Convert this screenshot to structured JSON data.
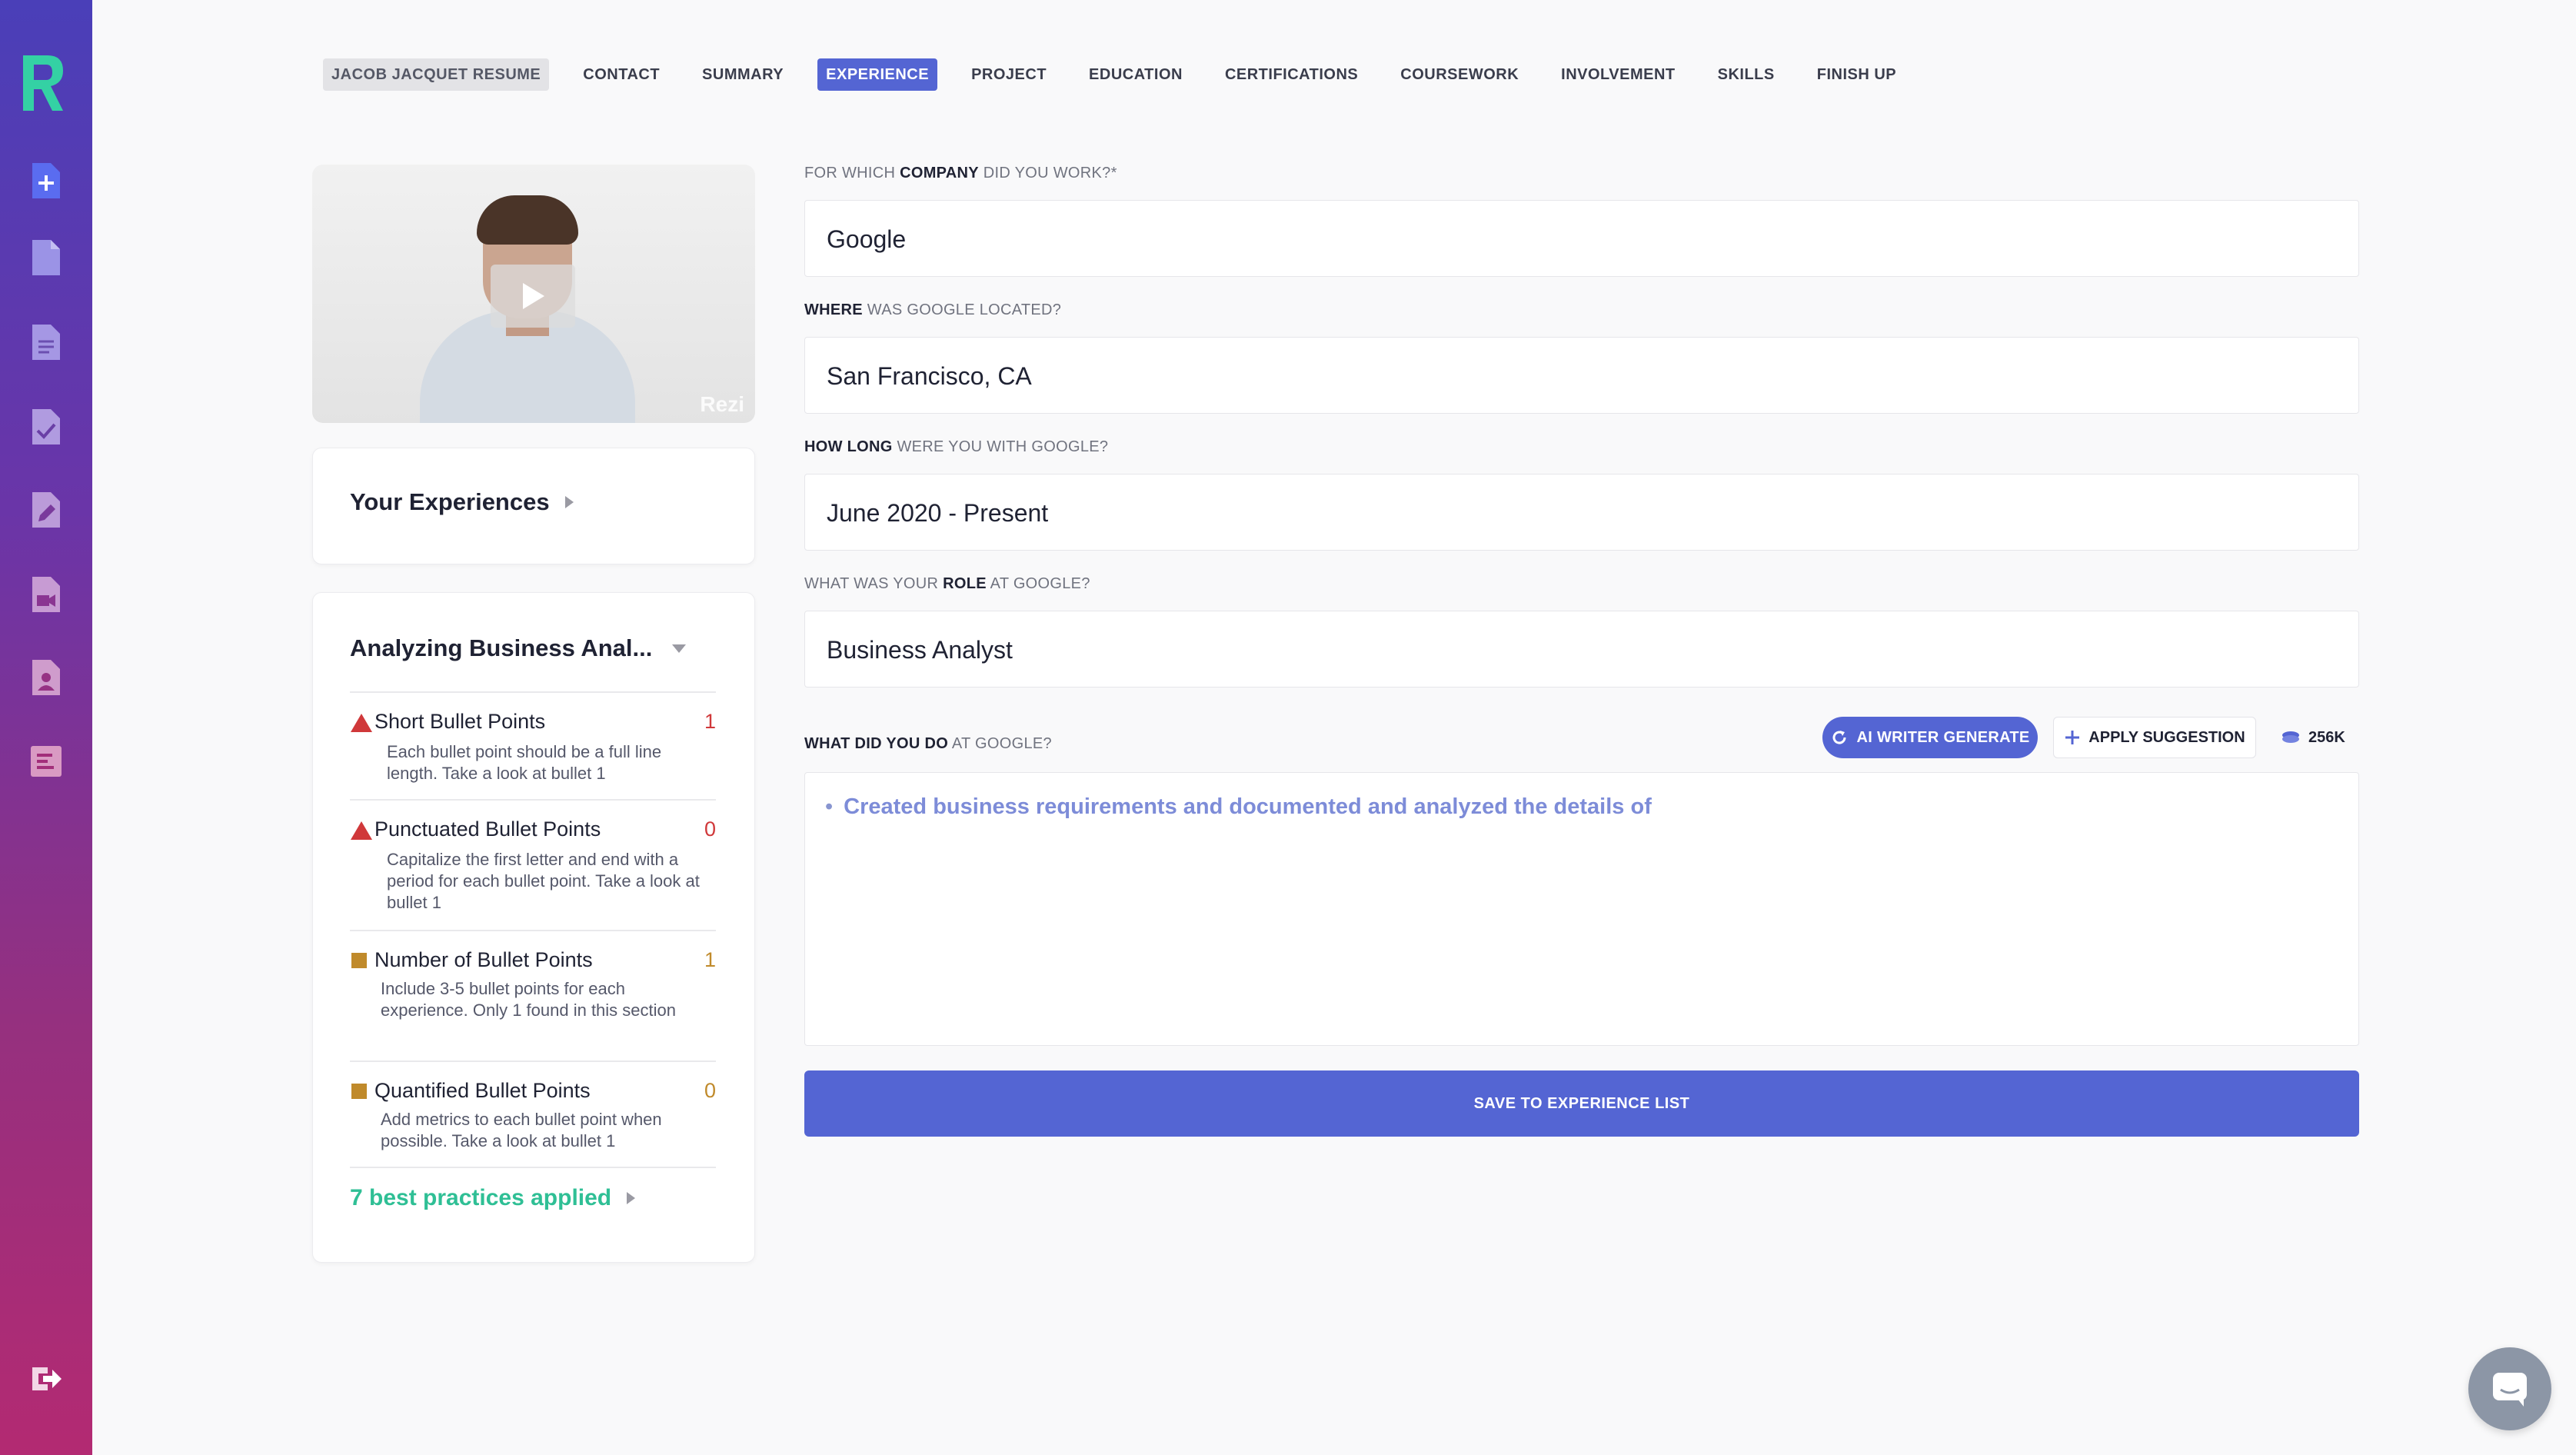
{
  "sidebar": {
    "logo": "rezi-logo",
    "items": [
      {
        "icon": "add-document-icon"
      },
      {
        "icon": "document-icon"
      },
      {
        "icon": "text-document-icon"
      },
      {
        "icon": "checked-document-icon"
      },
      {
        "icon": "edit-document-icon"
      },
      {
        "icon": "video-document-icon"
      },
      {
        "icon": "profile-document-icon"
      },
      {
        "icon": "report-icon"
      }
    ],
    "logout_icon": "logout-icon"
  },
  "nav": {
    "brand": "JACOB JACQUET RESUME",
    "items": [
      "CONTACT",
      "SUMMARY",
      "EXPERIENCE",
      "PROJECT",
      "EDUCATION",
      "CERTIFICATIONS",
      "COURSEWORK",
      "INVOLVEMENT",
      "SKILLS",
      "FINISH UP"
    ],
    "active": "EXPERIENCE"
  },
  "video": {
    "watermark": "Rezi"
  },
  "experiences": {
    "title": "Your Experiences"
  },
  "analysis": {
    "title": "Analyzing Business Anal...",
    "items": [
      {
        "name": "Short Bullet Points",
        "count": "1",
        "level": "error",
        "desc": "Each bullet point should be a full line length. Take a look at bullet 1"
      },
      {
        "name": "Punctuated Bullet Points",
        "count": "0",
        "level": "error",
        "desc": "Capitalize the first letter and end with a period for each bullet point. Take a look at bullet 1"
      },
      {
        "name": "Number of Bullet Points",
        "count": "1",
        "level": "warning",
        "desc": "Include 3-5 bullet points for each experience. Only 1 found in this section"
      },
      {
        "name": "Quantified Bullet Points",
        "count": "0",
        "level": "warning",
        "desc": "Add metrics to each bullet point when possible. Take a look at bullet 1"
      }
    ],
    "best_practices": "7 best practices applied"
  },
  "form": {
    "company": {
      "label_pre": "FOR WHICH ",
      "label_bold": "COMPANY",
      "label_post": " DID YOU WORK?*",
      "value": "Google"
    },
    "location": {
      "label_pre": "",
      "label_bold": "WHERE",
      "label_post": " WAS GOOGLE LOCATED?",
      "value": "San Francisco, CA"
    },
    "duration": {
      "label_pre": "",
      "label_bold": "HOW LONG",
      "label_post": " WERE YOU WITH GOOGLE?",
      "value": "June 2020 - Present"
    },
    "role": {
      "label_pre": "WHAT WAS YOUR ",
      "label_bold": "ROLE",
      "label_post": " AT GOOGLE?",
      "value": "Business Analyst"
    },
    "duties": {
      "label_pre": "",
      "label_bold": "WHAT DID YOU DO",
      "label_post": " AT GOOGLE?",
      "bullet": "Created business requirements and documented and analyzed the details of"
    },
    "ai_button": "AI WRITER GENERATE",
    "apply_button": "APPLY SUGGESTION",
    "credits": "256K",
    "save_button": "SAVE TO EXPERIENCE LIST"
  },
  "colors": {
    "accent": "#5465d3",
    "success": "#2fbf95",
    "error": "#d0383a",
    "warning": "#c08a2b"
  },
  "chat": {
    "icon": "chat-icon"
  }
}
